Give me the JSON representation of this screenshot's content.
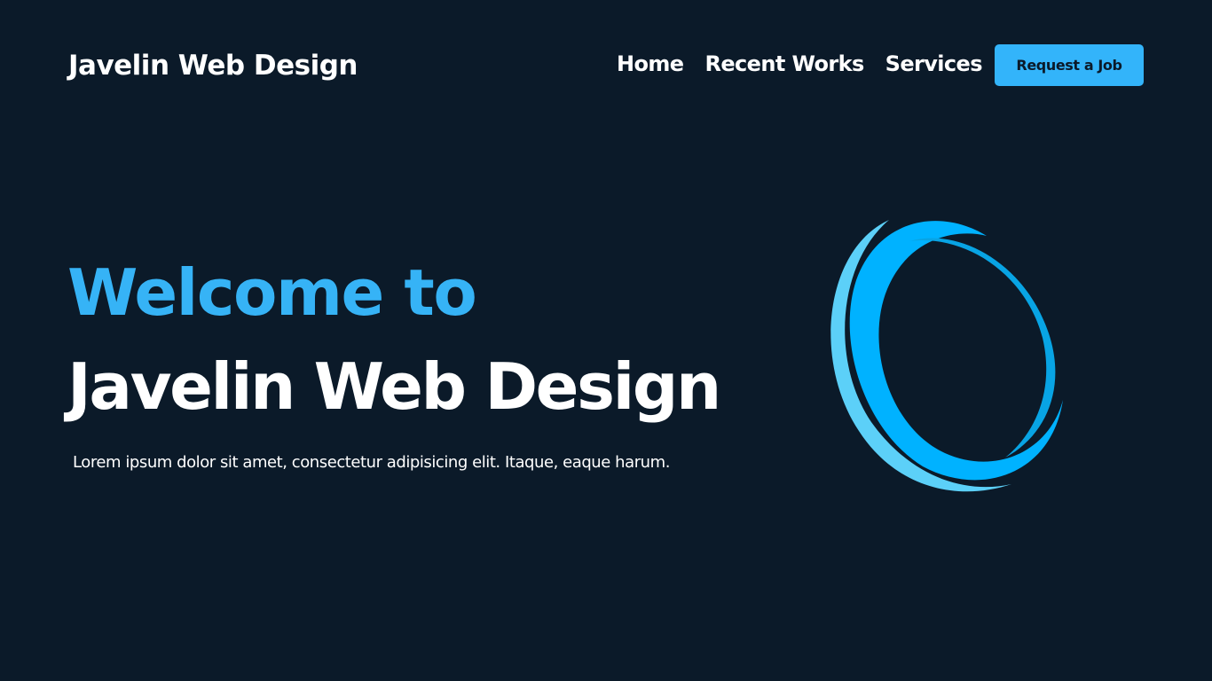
{
  "header": {
    "brand": "Javelin Web Design",
    "nav": {
      "home": "Home",
      "recent_works": "Recent Works",
      "services": "Services"
    },
    "cta_label": "Request a Job"
  },
  "hero": {
    "welcome": "Welcome to",
    "title": "Javelin Web Design",
    "subtitle": "Lorem ipsum dolor sit amet, consectetur adipisicing elit. Itaque, eaque harum."
  },
  "colors": {
    "background": "#0b1a29",
    "accent": "#33b4fa",
    "ring_primary": "#00b2ff",
    "ring_light": "#5cd0f8"
  },
  "icons": {
    "hero_graphic": "swirl-ring-icon"
  }
}
